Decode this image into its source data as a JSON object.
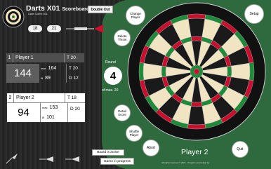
{
  "header": {
    "title_main": "Darts X01",
    "title_sub": "Scoreboard",
    "subtitle": "Darts Game 501",
    "double_out": "Double Out",
    "num_left": "18",
    "num_right": "21"
  },
  "player1": {
    "name": "Player 1",
    "number": "1",
    "score": "144",
    "max_label": "max",
    "max_value": "164",
    "avg_label": "Ø",
    "avg_value": "89",
    "tag1": "T 20",
    "tag2": "T 20",
    "tag3": "D 12"
  },
  "player2": {
    "name": "Player 2",
    "number": "2",
    "score": "94",
    "max_label": "max",
    "max_value": "153",
    "avg_label": "Ø",
    "avg_value": "101",
    "tag1": "T 18",
    "tag2": "D 20",
    "tag3": ""
  },
  "round": {
    "label": "Round",
    "value": "4",
    "max": "of max. 20"
  },
  "buttons": {
    "change_player": "Change Player",
    "delete_throw": "Delete Throw",
    "detail_score": "Detail Score",
    "shuffle_player": "Shuffle Player",
    "abort": "Abort",
    "setup": "Setup",
    "quit": "Quit"
  },
  "current_player": "Player 2",
  "footer": {
    "rights": "All rights reserved © 2021 · Program and design by",
    "board_active": "Board is active",
    "game_progress": "Game in progress"
  },
  "colors": {
    "green": "#2f6a3f",
    "board_red": "#c8102e",
    "board_green": "#1e8a3a",
    "board_cream": "#f1e4c3",
    "board_black": "#1a1a1a"
  },
  "icons": [
    "dartboard-logo-icon",
    "dart-icon"
  ]
}
